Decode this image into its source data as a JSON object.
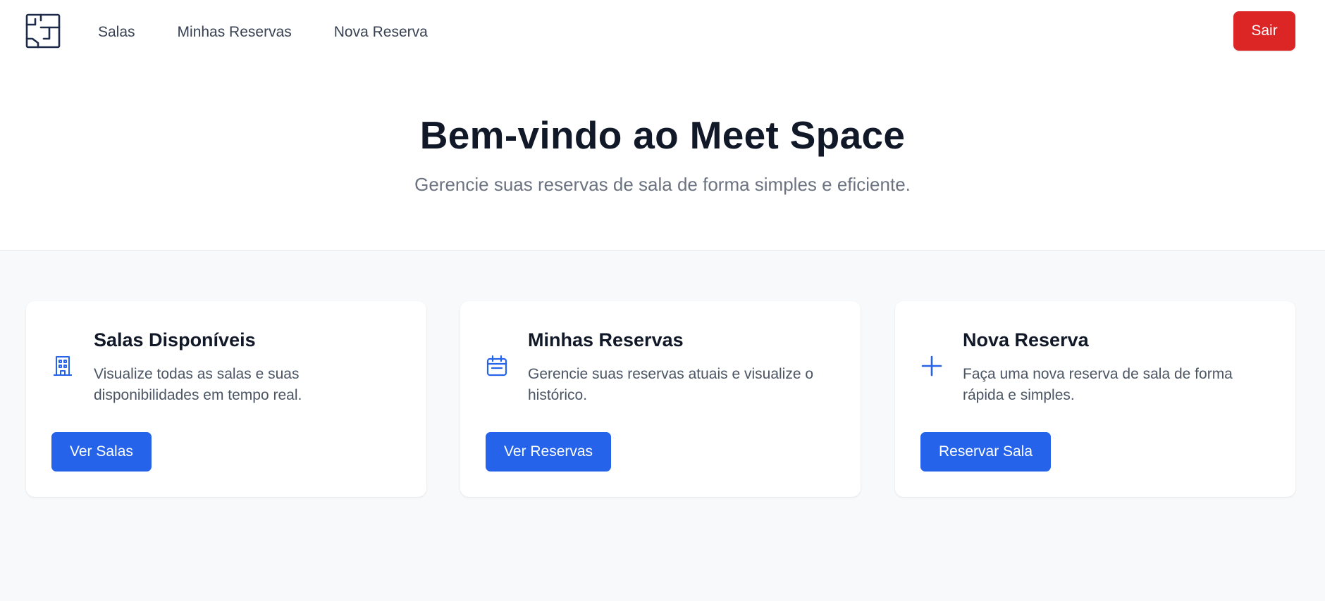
{
  "nav": {
    "links": [
      "Salas",
      "Minhas Reservas",
      "Nova Reserva"
    ],
    "logout_label": "Sair"
  },
  "hero": {
    "title": "Bem-vindo ao Meet Space",
    "subtitle": "Gerencie suas reservas de sala de forma simples e eficiente."
  },
  "cards": [
    {
      "icon": "building-icon",
      "title": "Salas Disponíveis",
      "description": "Visualize todas as salas e suas disponibilidades em tempo real.",
      "button_label": "Ver Salas"
    },
    {
      "icon": "calendar-icon",
      "title": "Minhas Reservas",
      "description": "Gerencie suas reservas atuais e visualize o histórico.",
      "button_label": "Ver Reservas"
    },
    {
      "icon": "plus-icon",
      "title": "Nova Reserva",
      "description": "Faça uma nova reserva de sala de forma rápida e simples.",
      "button_label": "Reservar Sala"
    }
  ],
  "colors": {
    "primary": "#2563eb",
    "danger": "#dc2626",
    "heading": "#111827",
    "muted": "#6b7280",
    "background": "#f8f9fa",
    "logo": "#1e2a4a"
  }
}
